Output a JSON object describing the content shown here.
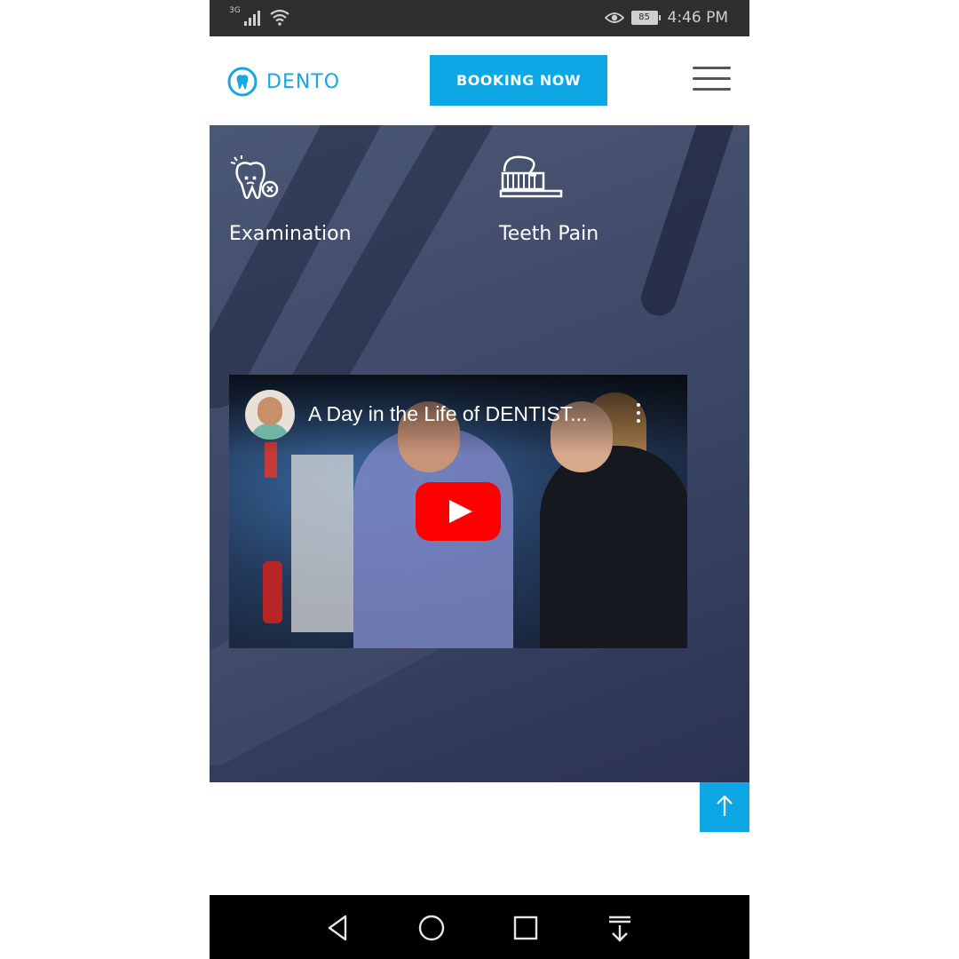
{
  "status_bar": {
    "network": "3G",
    "battery": "85",
    "time": "4:46 PM"
  },
  "header": {
    "brand": "DENTO",
    "booking_label": "BOOKING NOW"
  },
  "services": [
    {
      "label": "Examination",
      "icon": "tooth-examination-icon"
    },
    {
      "label": "Teeth Pain",
      "icon": "toothbrush-icon"
    }
  ],
  "video": {
    "title": "A Day in the Life of DENTIST..."
  },
  "colors": {
    "accent": "#0ea7e6",
    "brand": "#1aa6e0",
    "hero": "#3f4a69",
    "play": "#ff0000"
  }
}
